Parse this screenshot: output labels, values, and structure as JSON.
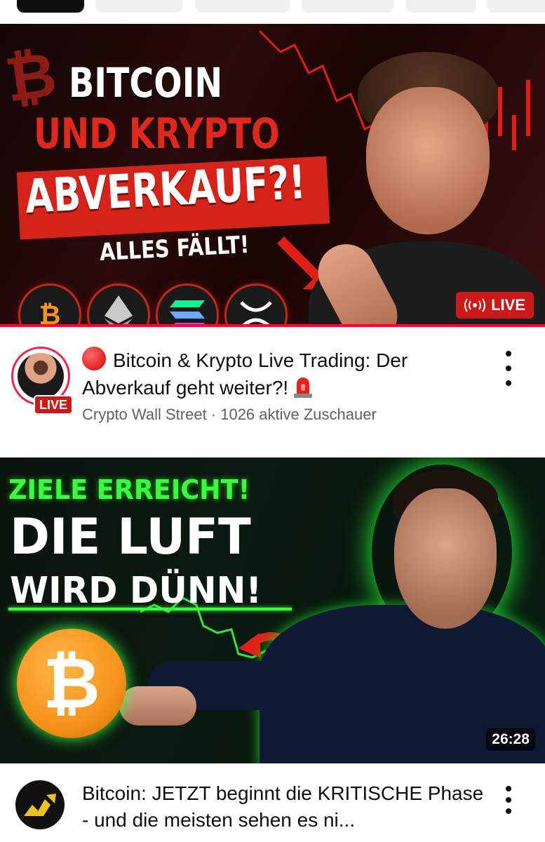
{
  "filter_chips": [
    "",
    "",
    "",
    "",
    "",
    ""
  ],
  "video1": {
    "thumbnail_text": {
      "line1": "BITCOIN",
      "line2": "UND KRYPTO",
      "line3": "ABVERKAUF?!",
      "line4": "ALLES FÄLLT!",
      "bg_symbol": "₿"
    },
    "coin_icons": [
      "bitcoin-icon",
      "ethereum-icon",
      "solana-icon",
      "xrp-icon"
    ],
    "live_badge": "LIVE",
    "avatar_live_label": "LIVE",
    "title": "Bitcoin & Krypto Live Trading: Der Abverkauf geht weiter?!",
    "channel_info": "Crypto Wall Street · 1026 aktive Zuschauer",
    "colors": {
      "live_red": "#cc1a1a",
      "progress_red": "#ff0033"
    }
  },
  "video2": {
    "thumbnail_text": {
      "line1": "ZIELE ERREICHT!",
      "line2": "DIE LUFT",
      "line3": "WIRD DÜNN!",
      "coin_symbol": "₿"
    },
    "duration": "26:28",
    "title": "Bitcoin: JETZT beginnt die KRITISCHE Phase - und die meisten sehen es ni...",
    "colors": {
      "accent_green": "#39ff3f",
      "bitcoin_orange": "#f7931a"
    }
  }
}
